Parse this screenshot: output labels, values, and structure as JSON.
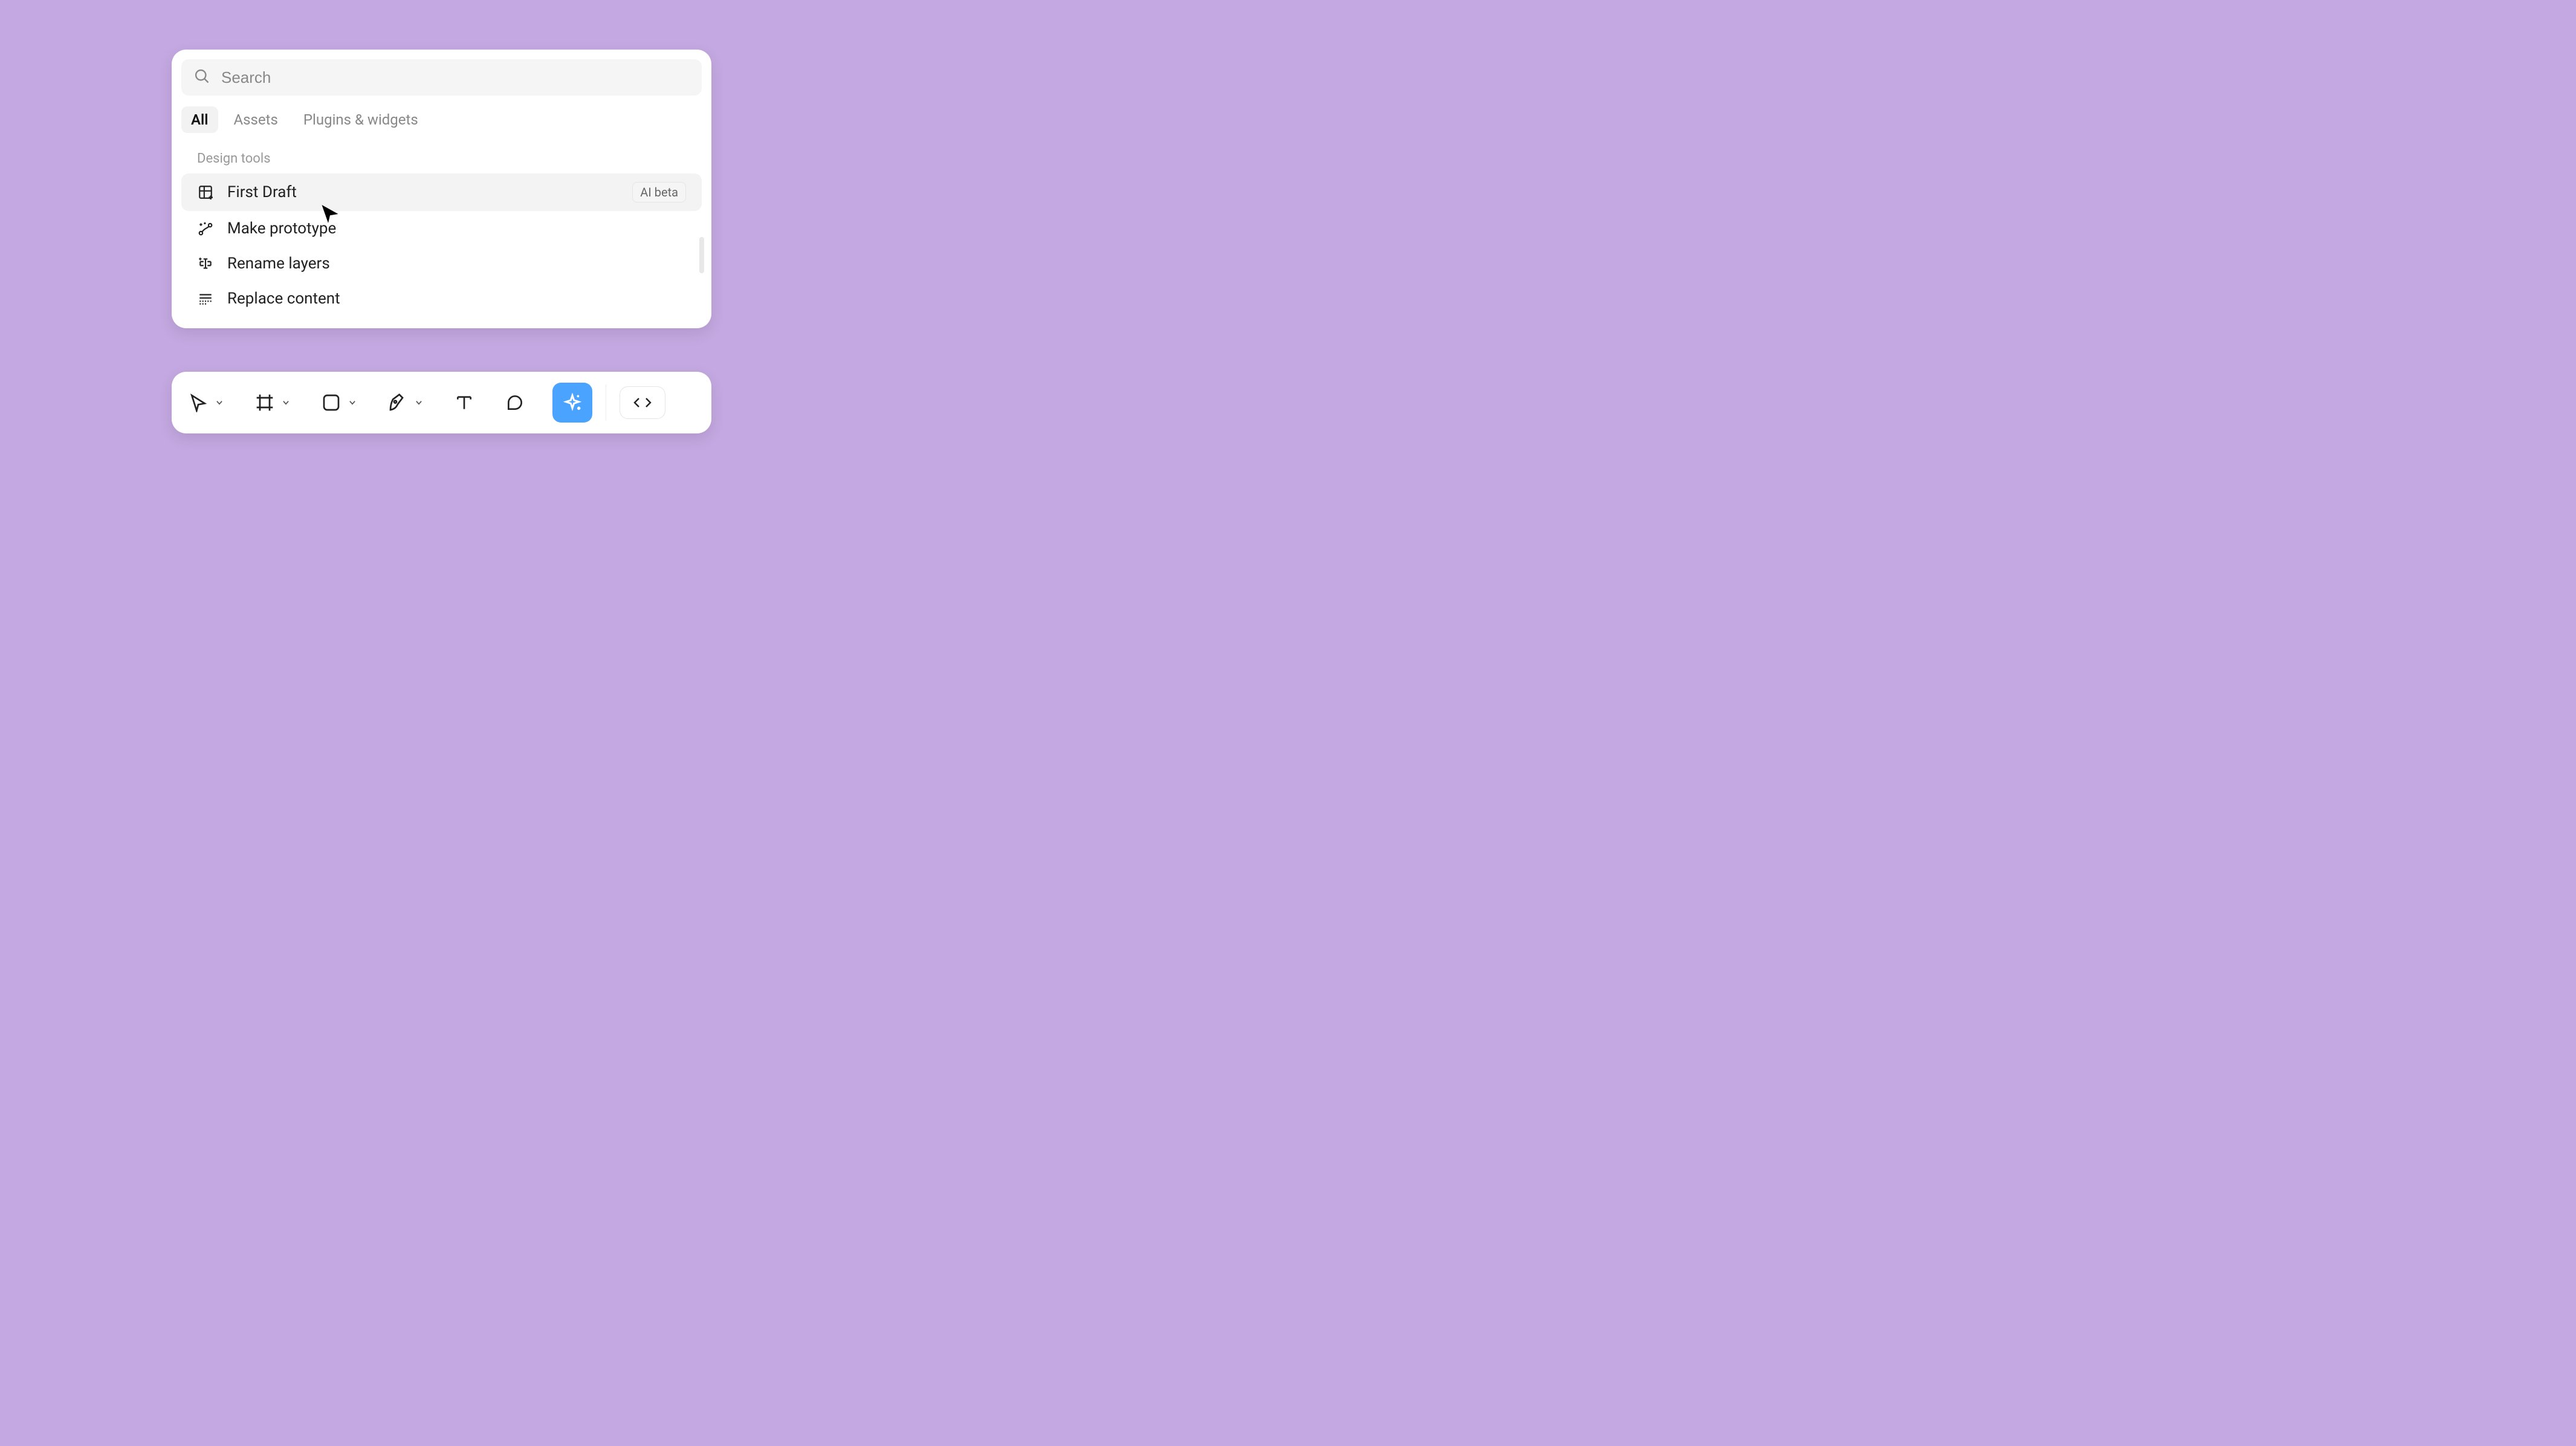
{
  "search": {
    "placeholder": "Search"
  },
  "tabs": {
    "all": "All",
    "assets": "Assets",
    "plugins": "Plugins & widgets"
  },
  "section": {
    "label": "Design tools"
  },
  "items": [
    {
      "label": "First Draft",
      "badge": "AI beta"
    },
    {
      "label": "Make prototype"
    },
    {
      "label": "Rename layers"
    },
    {
      "label": "Replace content"
    }
  ]
}
